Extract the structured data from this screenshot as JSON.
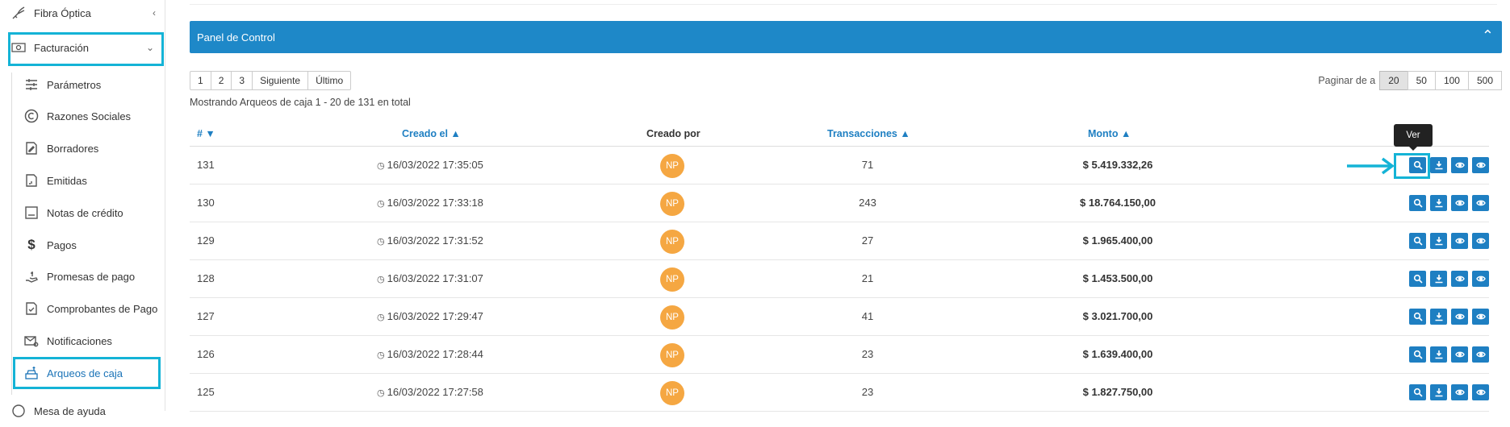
{
  "sidebar": {
    "fibra": "Fibra Óptica",
    "facturacion": "Facturación",
    "items": [
      {
        "label": "Parámetros",
        "icon": "sliders-icon"
      },
      {
        "label": "Razones Sociales",
        "icon": "copyright-icon"
      },
      {
        "label": "Borradores",
        "icon": "draft-document-icon"
      },
      {
        "label": "Emitidas",
        "icon": "issued-document-icon"
      },
      {
        "label": "Notas de crédito",
        "icon": "credit-note-icon"
      },
      {
        "label": "Pagos",
        "icon": "dollar-icon"
      },
      {
        "label": "Promesas de pago",
        "icon": "hand-money-icon"
      },
      {
        "label": "Comprobantes de Pago",
        "icon": "receipt-check-icon"
      },
      {
        "label": "Notificaciones",
        "icon": "envelope-gear-icon"
      },
      {
        "label": "Arqueos de caja",
        "icon": "cash-register-icon"
      }
    ],
    "mesa": "Mesa de ayuda"
  },
  "panel": {
    "title": "Panel de Control"
  },
  "pagination": {
    "pages": [
      "1",
      "2",
      "3"
    ],
    "next": "Siguiente",
    "last": "Último"
  },
  "showing": "Mostrando Arqueos de caja 1 - 20 de 131 en total",
  "per_page": {
    "label": "Paginar de a",
    "options": [
      "20",
      "50",
      "100",
      "500"
    ],
    "selected": "20"
  },
  "table": {
    "headers": {
      "id": "# ▼",
      "created": "Creado el ▲",
      "by": "Creado por",
      "tx": "Transacciones ▲",
      "amount": "Monto ▲"
    },
    "rows": [
      {
        "id": "131",
        "date": "16/03/2022 17:35:05",
        "by": "NP",
        "tx": "71",
        "amount": "$ 5.419.332,26"
      },
      {
        "id": "130",
        "date": "16/03/2022 17:33:18",
        "by": "NP",
        "tx": "243",
        "amount": "$ 18.764.150,00"
      },
      {
        "id": "129",
        "date": "16/03/2022 17:31:52",
        "by": "NP",
        "tx": "27",
        "amount": "$ 1.965.400,00"
      },
      {
        "id": "128",
        "date": "16/03/2022 17:31:07",
        "by": "NP",
        "tx": "21",
        "amount": "$ 1.453.500,00"
      },
      {
        "id": "127",
        "date": "16/03/2022 17:29:47",
        "by": "NP",
        "tx": "41",
        "amount": "$ 3.021.700,00"
      },
      {
        "id": "126",
        "date": "16/03/2022 17:28:44",
        "by": "NP",
        "tx": "23",
        "amount": "$ 1.639.400,00"
      },
      {
        "id": "125",
        "date": "16/03/2022 17:27:58",
        "by": "NP",
        "tx": "23",
        "amount": "$ 1.827.750,00"
      }
    ]
  },
  "tooltip": "Ver",
  "colors": {
    "primary": "#1e88c8",
    "highlight": "#14b3d6",
    "badge": "#f5a742"
  }
}
